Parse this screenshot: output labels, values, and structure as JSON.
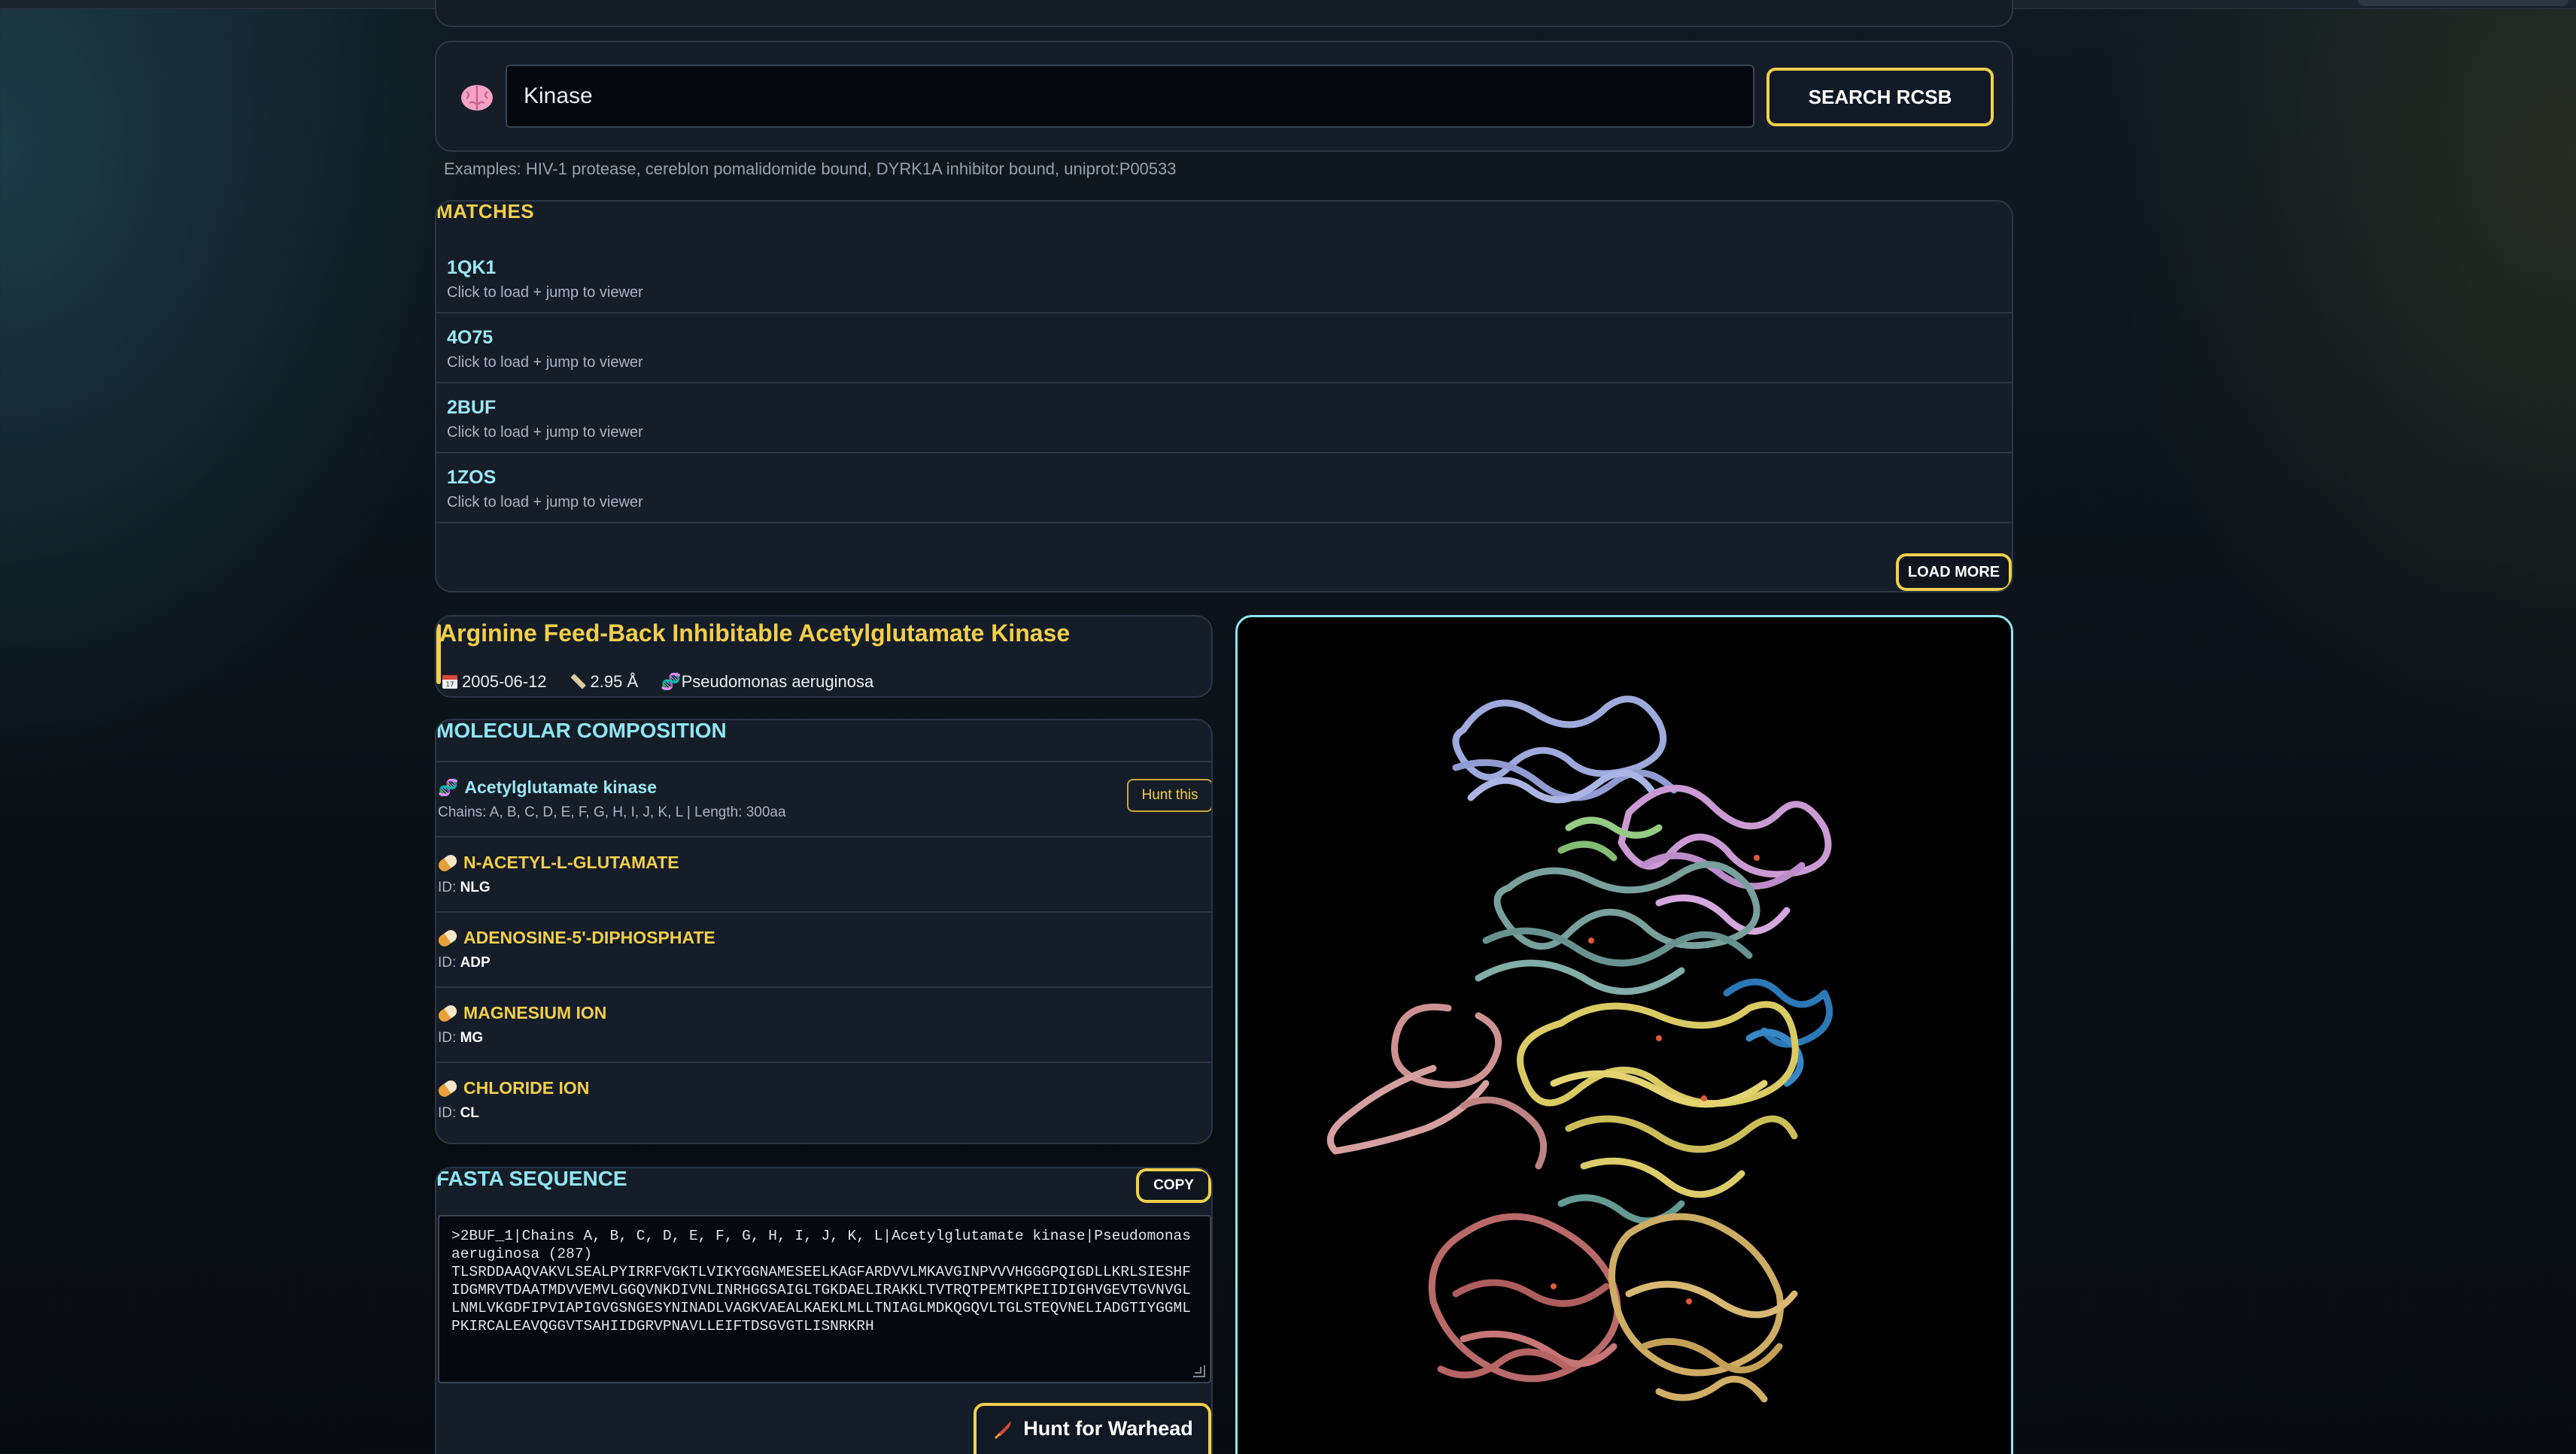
{
  "search": {
    "value": "Kinase",
    "button_label": "SEARCH RCSB",
    "examples": "Examples: HIV-1 protease, cereblon pomalidomide bound, DYRK1A inhibitor bound, uniprot:P00533"
  },
  "matches": {
    "title": "MATCHES",
    "items": [
      {
        "id": "1QK1",
        "sub": "Click to load + jump to viewer"
      },
      {
        "id": "4O75",
        "sub": "Click to load + jump to viewer"
      },
      {
        "id": "2BUF",
        "sub": "Click to load + jump to viewer"
      },
      {
        "id": "1ZOS",
        "sub": "Click to load + jump to viewer"
      }
    ],
    "load_more": "LOAD MORE"
  },
  "structure": {
    "title": "Arginine Feed-Back Inhibitable Acetylglutamate Kinase",
    "date": "2005-06-12",
    "resolution": "2.95 Å",
    "organism": "Pseudomonas aeruginosa"
  },
  "composition": {
    "title": "MOLECULAR COMPOSITION",
    "protein": {
      "name": "Acetylglutamate kinase",
      "detail": "Chains: A, B, C, D, E, F, G, H, I, J, K, L | Length: 300aa",
      "button": "Hunt this"
    },
    "ligands": [
      {
        "name": "N-ACETYL-L-GLUTAMATE",
        "id_label": "ID:",
        "id": "NLG"
      },
      {
        "name": "ADENOSINE-5'-DIPHOSPHATE",
        "id_label": "ID:",
        "id": "ADP"
      },
      {
        "name": "MAGNESIUM ION",
        "id_label": "ID:",
        "id": "MG"
      },
      {
        "name": "CHLORIDE ION",
        "id_label": "ID:",
        "id": "CL"
      }
    ]
  },
  "fasta": {
    "title": "FASTA SEQUENCE",
    "copy": "COPY",
    "text": ">2BUF_1|Chains A, B, C, D, E, F, G, H, I, J, K, L|Acetylglutamate kinase|Pseudomonas aeruginosa (287)\nTLSRDDAAQVAKVLSEALPYIRRFVGKTLVIKYGGNAMESEELKAGFARDVVLMKAVGINPVVVHGGGPQIGDLLKRLSIESHFIDGMRVTDAATMDVVEMVLGGQVNKDIVNLINRHGGSAIGLTGKDAELIRAKKLTVTRQTPEMTKPEIIDIGHVGEVTGVNVGLLNMLVKGDFIPVIAPIGVGSNGESYNINADLVAGKVAEALKAEKLMLLTNIAGLMDKQGQVLTGLSTEQVNELIADGTIYGGMLPKIRCALEAVQGGVTSAHIIDGRVPNAVLLEIFTDSGVGTLISNRKRH",
    "hunt_button": "Hunt for Warhead"
  },
  "icons": {
    "brain": "brain-icon",
    "calendar": "calendar-icon",
    "ruler": "ruler-icon",
    "dna": "dna-icon",
    "pill": "pill-icon",
    "warhead": "warhead-icon"
  },
  "colors": {
    "accent_yellow": "#f2cf4a",
    "accent_cyan": "#8ee6f0",
    "card_bg": "#151d29"
  }
}
